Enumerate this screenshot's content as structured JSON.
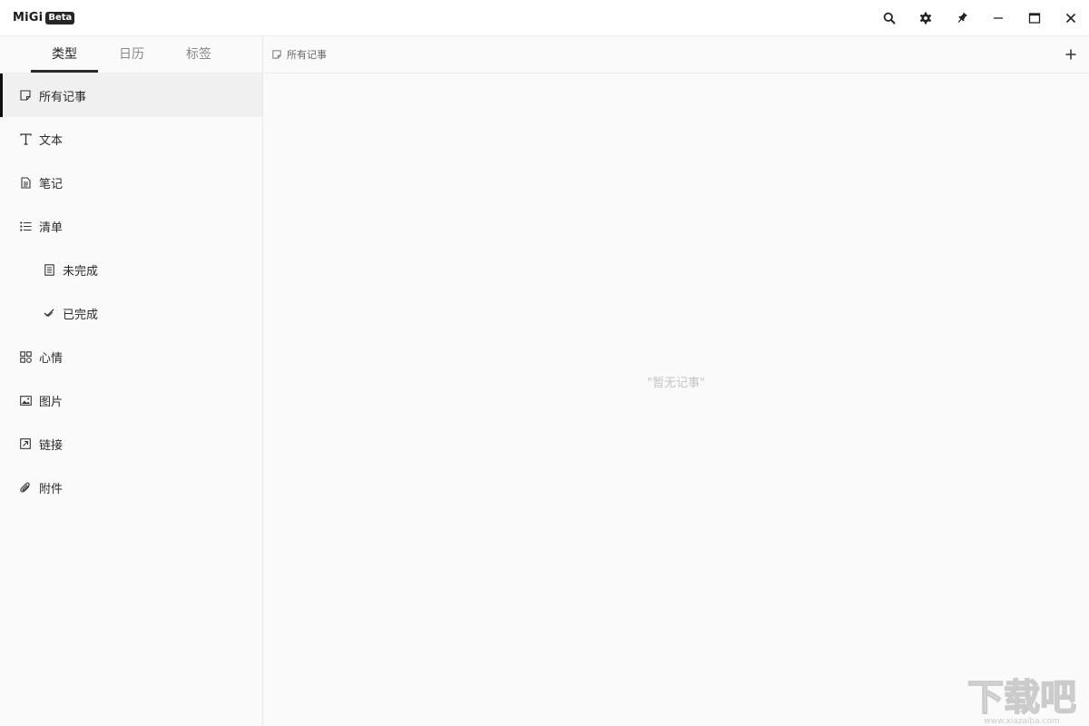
{
  "app": {
    "name": "MiGi",
    "badge": "Beta"
  },
  "window_controls": [
    {
      "name": "search-icon"
    },
    {
      "name": "gear-icon"
    },
    {
      "name": "pin-icon"
    },
    {
      "name": "minimize-icon"
    },
    {
      "name": "maximize-icon"
    },
    {
      "name": "close-icon"
    }
  ],
  "sidebar": {
    "tabs": [
      {
        "label": "类型",
        "active": true
      },
      {
        "label": "日历",
        "active": false
      },
      {
        "label": "标签",
        "active": false
      }
    ],
    "items": [
      {
        "label": "所有记事",
        "icon": "note-icon",
        "active": true
      },
      {
        "label": "文本",
        "icon": "text-icon"
      },
      {
        "label": "笔记",
        "icon": "document-icon"
      },
      {
        "label": "清单",
        "icon": "list-icon"
      },
      {
        "label": "未完成",
        "icon": "checklist-icon",
        "sub": true
      },
      {
        "label": "已完成",
        "icon": "double-check-icon",
        "sub": true
      },
      {
        "label": "心情",
        "icon": "mood-icon"
      },
      {
        "label": "图片",
        "icon": "image-icon"
      },
      {
        "label": "链接",
        "icon": "link-icon"
      },
      {
        "label": "附件",
        "icon": "paperclip-icon"
      }
    ]
  },
  "main": {
    "breadcrumb": "所有记事",
    "empty_text": "\"暂无记事\""
  },
  "watermark": {
    "text": "下载吧",
    "sub": "www.xiazaiba.com"
  }
}
